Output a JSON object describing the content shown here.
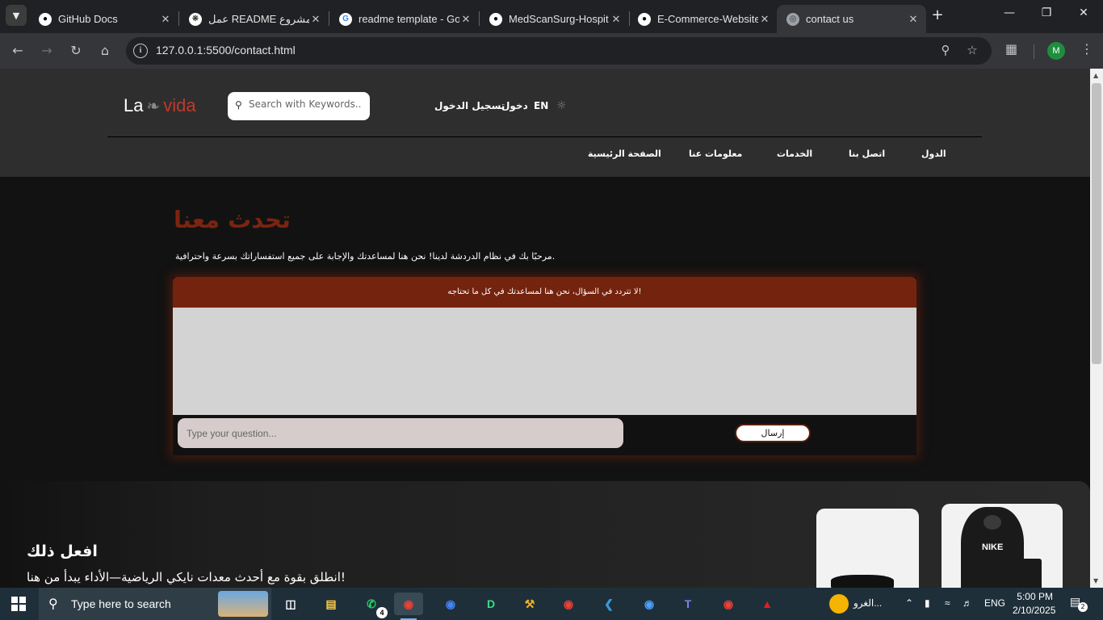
{
  "browser": {
    "tabs": [
      {
        "title": "GitHub Docs",
        "icon": "github-icon"
      },
      {
        "title": "عمل README لمشروع",
        "icon": "openai-icon"
      },
      {
        "title": "readme template - Go",
        "icon": "google-icon"
      },
      {
        "title": "MedScanSurg-Hospit",
        "icon": "github-icon"
      },
      {
        "title": "E-Commerce-Website",
        "icon": "github-icon"
      },
      {
        "title": "contact us",
        "icon": "globe-icon",
        "active": true
      }
    ],
    "url": "127.0.0.1:5500/contact.html",
    "profile_initial": "M"
  },
  "site": {
    "logo": {
      "la": "La",
      "vida": "vida"
    },
    "search_placeholder": "Search with Keywords...",
    "header_links": {
      "register": "تسجيل الدخول",
      "login": "دخول",
      "lang": "EN"
    },
    "nav": [
      "الدول",
      "اتصل بنا",
      "الخدمات",
      "معلومات عنا",
      "الصفحة الرئيسية"
    ]
  },
  "chat": {
    "title": "تحدث معنا",
    "subtitle": "مرحبًا بك في نظام الدردشة لدينا! نحن هنا لمساعدتك والإجابة على جميع استفساراتك بسرعة واحترافية.",
    "header": "لا تتردد في السؤال، نحن هنا لمساعدتك في كل ما تحتاجه!",
    "input_placeholder": "Type your question...",
    "send_label": "إرسال"
  },
  "promo": {
    "title": "افعل ذلك",
    "text": "انطلق بقوة مع أحدث معدات نايكي الرياضية—الأداء يبدأ من هنا!",
    "brand": "NIKE"
  },
  "taskbar": {
    "search_text": "Type here to search",
    "whatsapp_badge": "4",
    "weather": "الغرو...",
    "lang": "ENG",
    "time": "5:00 PM",
    "date": "2/10/2025",
    "notifications": "2"
  }
}
